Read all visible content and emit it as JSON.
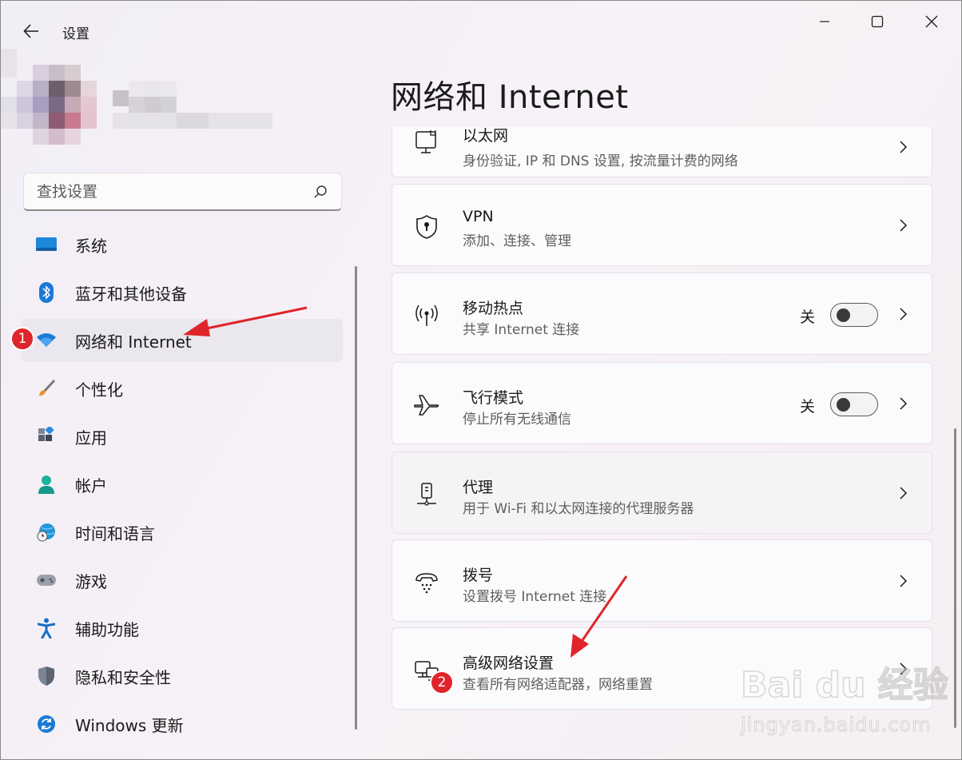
{
  "app": {
    "title": "设置"
  },
  "search": {
    "placeholder": "查找设置"
  },
  "nav": {
    "items": [
      {
        "label": "系统",
        "icon": "monitor-icon"
      },
      {
        "label": "蓝牙和其他设备",
        "icon": "bluetooth-icon"
      },
      {
        "label": "网络和 Internet",
        "icon": "wifi-icon",
        "active": true
      },
      {
        "label": "个性化",
        "icon": "brush-icon"
      },
      {
        "label": "应用",
        "icon": "apps-icon"
      },
      {
        "label": "帐户",
        "icon": "account-icon"
      },
      {
        "label": "时间和语言",
        "icon": "globe-clock-icon"
      },
      {
        "label": "游戏",
        "icon": "gamepad-icon"
      },
      {
        "label": "辅助功能",
        "icon": "accessibility-icon"
      },
      {
        "label": "隐私和安全性",
        "icon": "shield-icon"
      },
      {
        "label": "Windows 更新",
        "icon": "update-icon"
      }
    ]
  },
  "main": {
    "title": "网络和 Internet",
    "cards": [
      {
        "title": "以太网",
        "subtitle": "身份验证, IP 和 DNS 设置, 按流量计费的网络",
        "icon": "ethernet-icon"
      },
      {
        "title": "VPN",
        "subtitle": "添加、连接、管理",
        "icon": "vpn-shield-icon"
      },
      {
        "title": "移动热点",
        "subtitle": "共享 Internet 连接",
        "icon": "hotspot-icon",
        "toggle_label": "关",
        "toggle_on": false
      },
      {
        "title": "飞行模式",
        "subtitle": "停止所有无线通信",
        "icon": "airplane-icon",
        "toggle_label": "关",
        "toggle_on": false
      },
      {
        "title": "代理",
        "subtitle": "用于 Wi-Fi 和以太网连接的代理服务器",
        "icon": "proxy-icon"
      },
      {
        "title": "拨号",
        "subtitle": "设置拨号 Internet 连接",
        "icon": "dialup-icon"
      },
      {
        "title": "高级网络设置",
        "subtitle": "查看所有网络适配器，网络重置",
        "icon": "network-adapter-icon"
      }
    ]
  },
  "annotations": {
    "badge1": "1",
    "badge2": "2",
    "arrow_color": "#e0242b"
  },
  "watermark": {
    "main": "Bai du 经验",
    "sub": "jingyan.baidu.com"
  },
  "colors": {
    "accent": "#0067c0",
    "annotation": "#e0242b"
  }
}
